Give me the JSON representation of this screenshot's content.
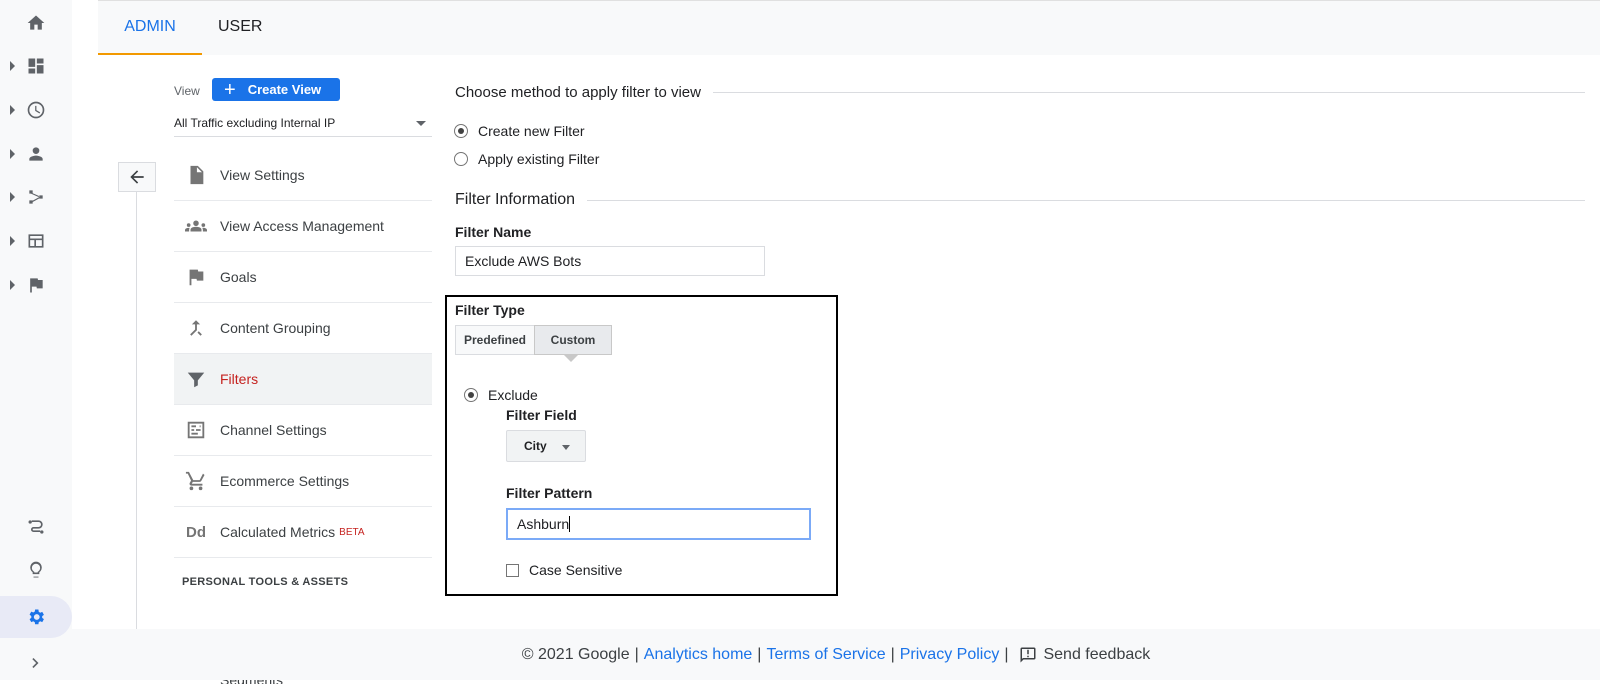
{
  "tabs": {
    "admin": "ADMIN",
    "user": "USER"
  },
  "view_selector": {
    "label": "View",
    "create_label": "Create View",
    "selected_view": "All Traffic excluding Internal IP"
  },
  "menu": {
    "items": [
      {
        "label": "View Settings"
      },
      {
        "label": "View Access Management"
      },
      {
        "label": "Goals"
      },
      {
        "label": "Content Grouping"
      },
      {
        "label": "Filters"
      },
      {
        "label": "Channel Settings"
      },
      {
        "label": "Ecommerce Settings"
      },
      {
        "label": "Calculated Metrics",
        "badge": "BETA"
      }
    ],
    "section_title": "PERSONAL TOOLS & ASSETS",
    "partial_item": "Segments"
  },
  "main": {
    "method_heading": "Choose method to apply filter to view",
    "method_options": [
      "Create new Filter",
      "Apply existing Filter"
    ],
    "info_heading": "Filter Information",
    "filter_name_label": "Filter Name",
    "filter_name_value": "Exclude AWS Bots",
    "filter_type_label": "Filter Type",
    "filter_type_options": [
      "Predefined",
      "Custom"
    ],
    "exclude_label": "Exclude",
    "filter_field_label": "Filter Field",
    "filter_field_value": "City",
    "filter_pattern_label": "Filter Pattern",
    "filter_pattern_value": "Ashburn",
    "case_sensitive_label": "Case Sensitive"
  },
  "footer": {
    "copyright": "© 2021 Google",
    "analytics_home": "Analytics home",
    "terms": "Terms of Service",
    "privacy": "Privacy Policy",
    "feedback": "Send feedback"
  },
  "colors": {
    "accent": "#1a73e8",
    "active_menu": "#c5221f",
    "tab_underline": "#f29900"
  }
}
